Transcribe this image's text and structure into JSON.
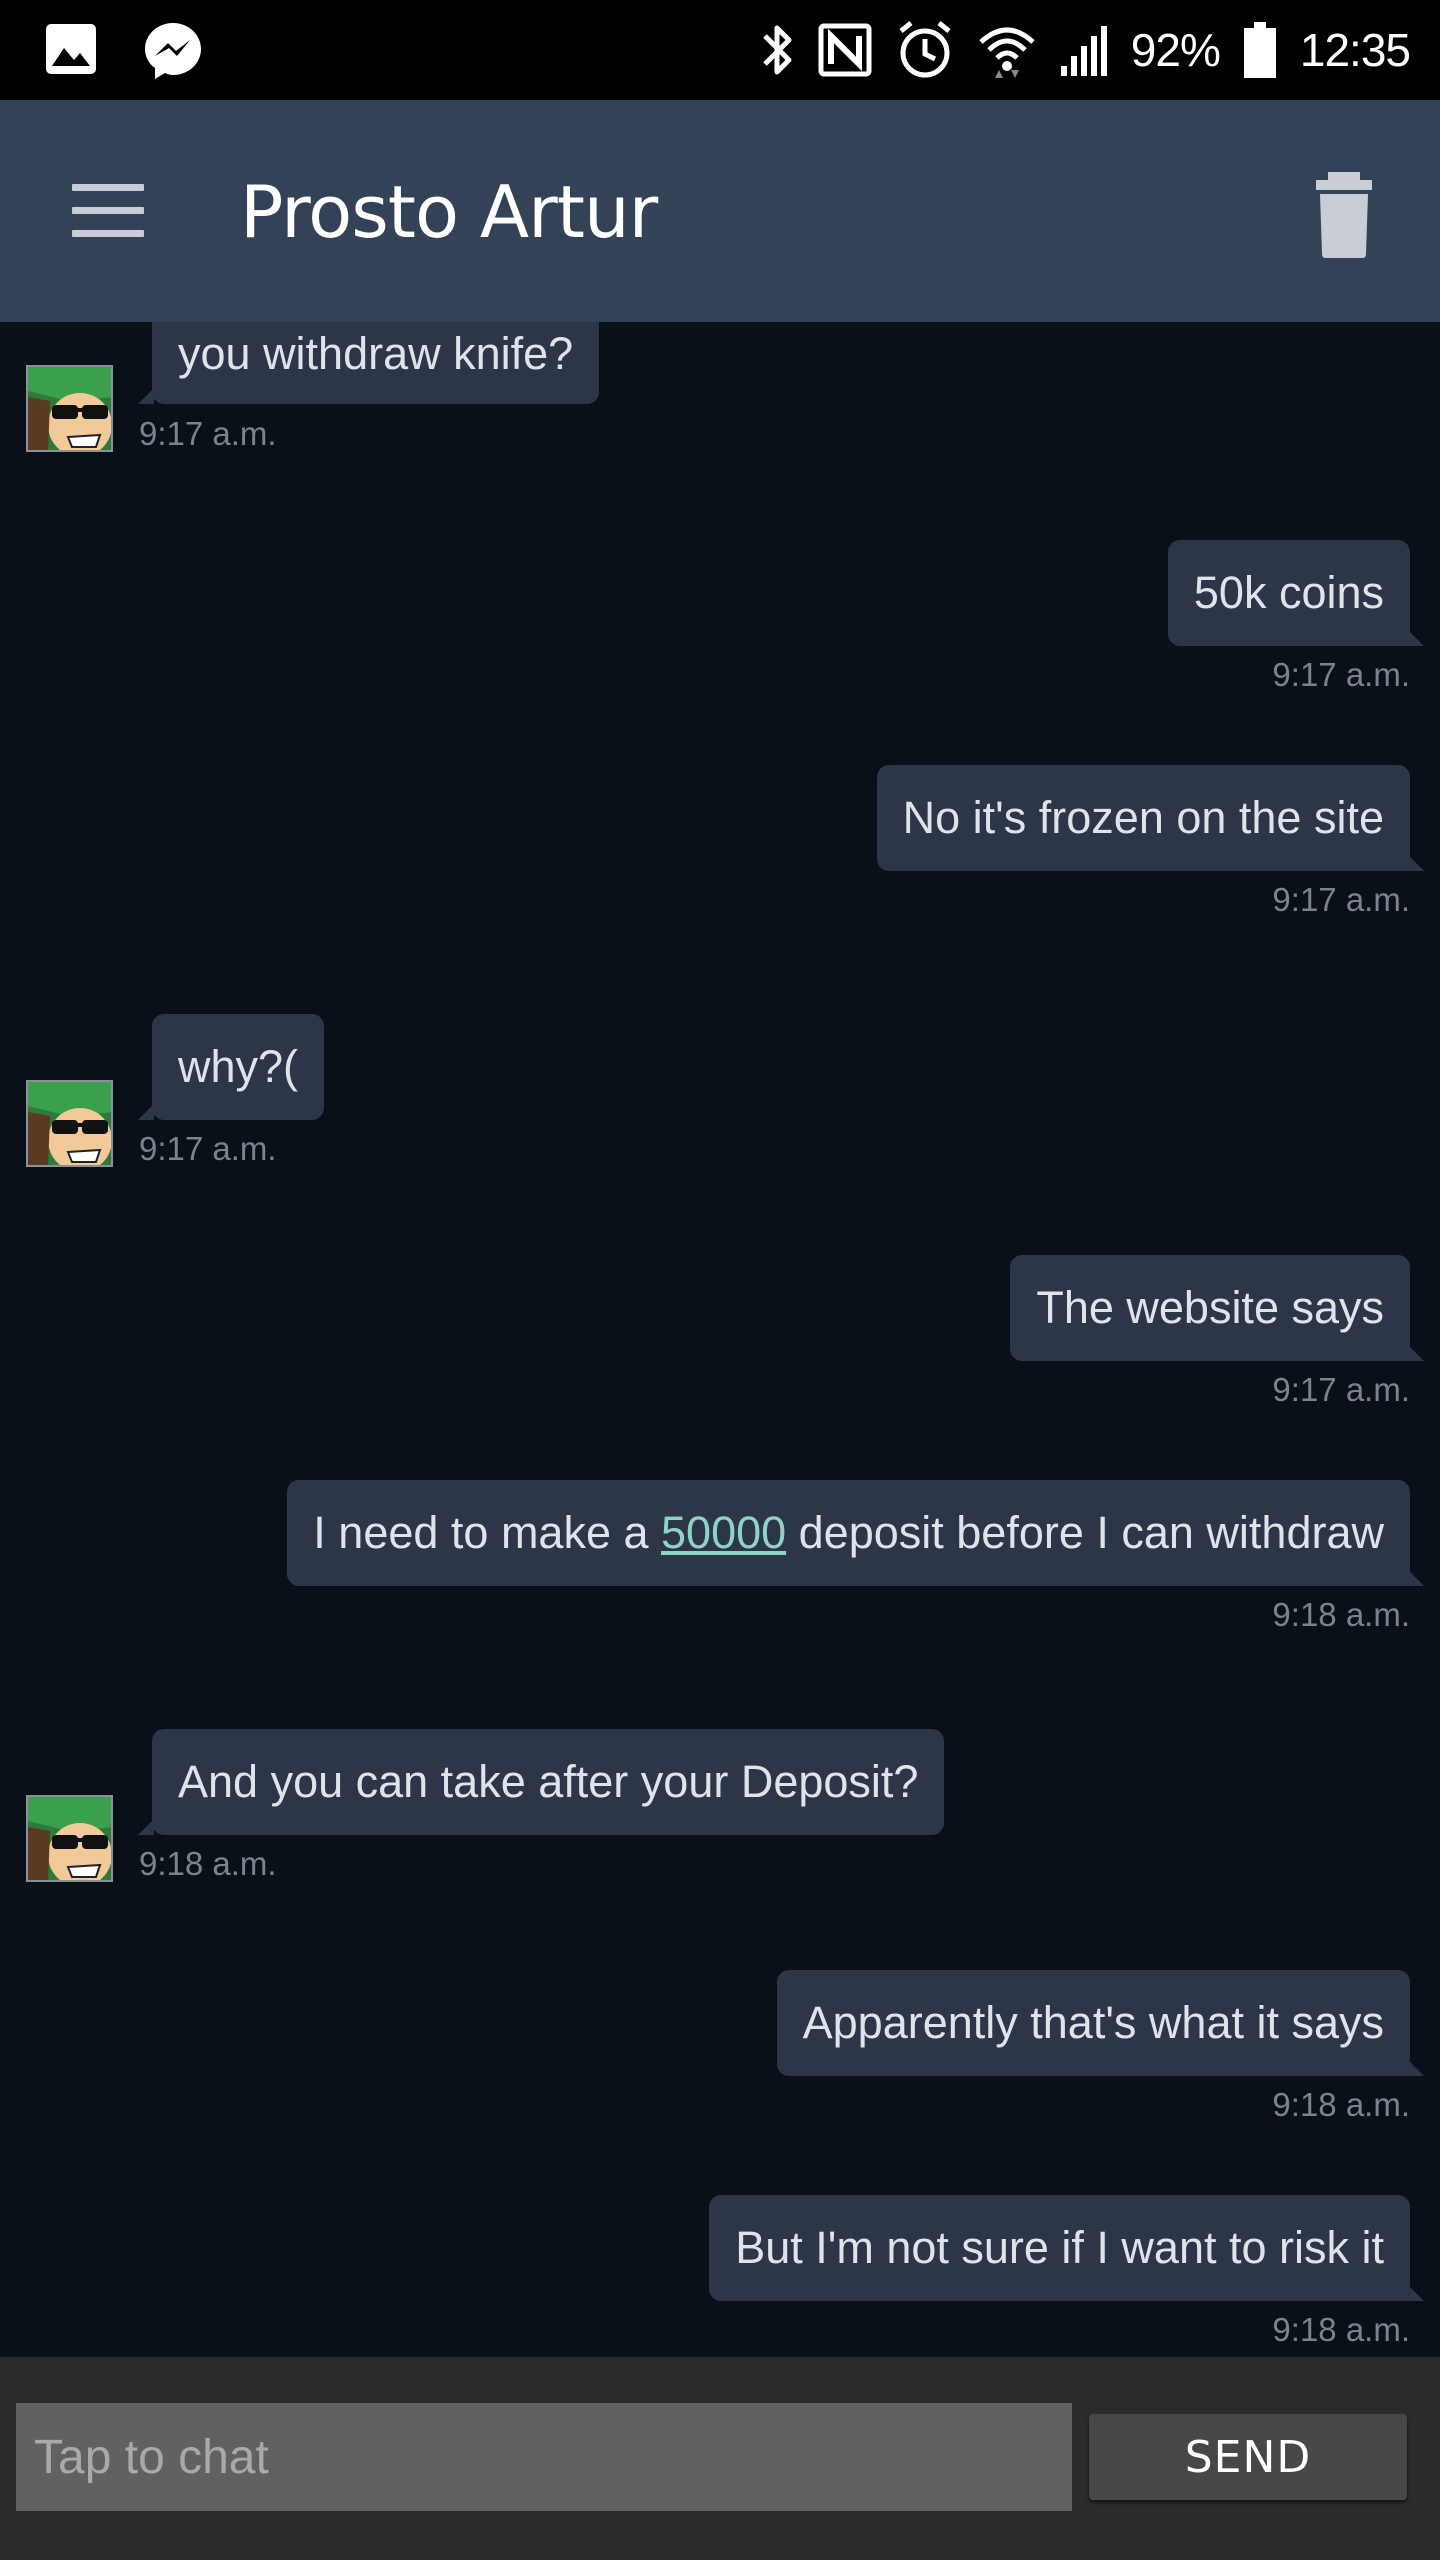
{
  "status_bar": {
    "left_icons": [
      "gallery-icon",
      "messenger-icon"
    ],
    "right_icons": [
      "bluetooth-icon",
      "nfc-icon",
      "alarm-icon",
      "wifi-icon",
      "signal-icon",
      "battery-icon"
    ],
    "battery": "92%",
    "time": "12:35"
  },
  "app_bar": {
    "title": "Prosto Artur",
    "menu_icon": "hamburger-menu-icon",
    "action_icon": "trash-icon"
  },
  "messages": [
    {
      "direction": "received",
      "text": "you withdraw knife?",
      "time": "9:17 a.m."
    },
    {
      "direction": "sent",
      "text": "50k coins",
      "time": "9:17 a.m."
    },
    {
      "direction": "sent",
      "text": "No it's frozen on the site",
      "time": "9:17 a.m."
    },
    {
      "direction": "received",
      "text": "why?(",
      "time": "9:17 a.m."
    },
    {
      "direction": "sent",
      "text": "The website says",
      "time": "9:17 a.m."
    },
    {
      "direction": "sent",
      "text_before": "I need to make a ",
      "link": "50000",
      "text_after": " deposit before I can withdraw",
      "time": "9:18 a.m."
    },
    {
      "direction": "received",
      "text": "And you can take after your Deposit?",
      "time": "9:18 a.m."
    },
    {
      "direction": "sent",
      "text": "Apparently that's what it says",
      "time": "9:18 a.m."
    },
    {
      "direction": "sent",
      "text": "But I'm not sure if I want to risk it",
      "time": "9:18 a.m."
    }
  ],
  "composer": {
    "placeholder": "Tap to chat",
    "value": "",
    "send_label": "SEND"
  },
  "colors": {
    "status_bar": "#000000",
    "app_bar": "#344257",
    "chat_background": "#0a1017",
    "bubble": "#2d3549",
    "link": "#8fd3c8",
    "composer": "#2b2b2b"
  }
}
